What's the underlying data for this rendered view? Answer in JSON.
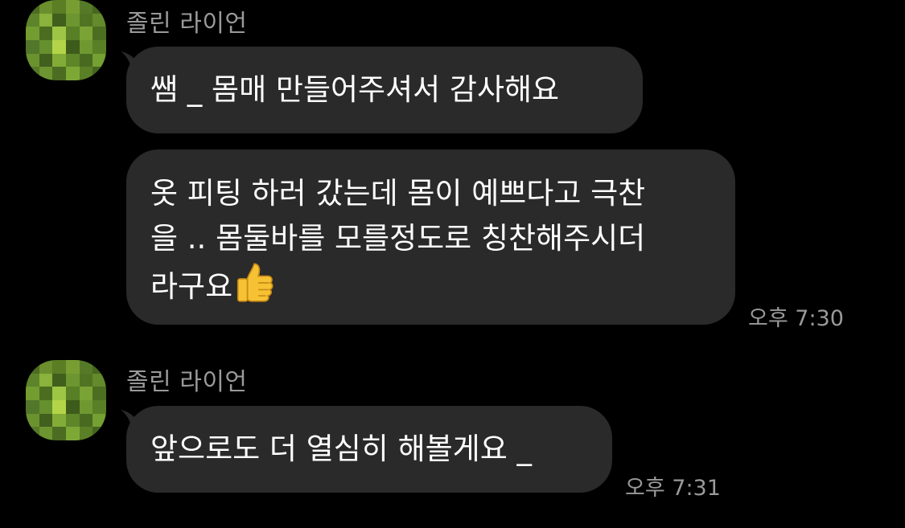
{
  "messages": [
    {
      "sender": "졸린 라이언",
      "bubbles": [
        {
          "lines": [
            "쌤 _ 몸매 만들어주셔서 감사해요"
          ]
        },
        {
          "lines": [
            "옷 피팅 하러 갔는데 몸이 예쁘다고 극찬",
            "을 .. 몸둘바를 모를정도로 칭찬해주시더",
            "라구요"
          ],
          "emoji": "thumbs-up"
        }
      ],
      "time": "오후 7:30"
    },
    {
      "sender": "졸린 라이언",
      "bubbles": [
        {
          "lines": [
            "앞으로도 더 열심히 해볼게요 _"
          ]
        }
      ],
      "time": "오후 7:31"
    }
  ],
  "colors": {
    "background": "#000000",
    "bubble": "#2a2a2a",
    "text": "#ffffff",
    "meta": "#9a9a9a"
  }
}
